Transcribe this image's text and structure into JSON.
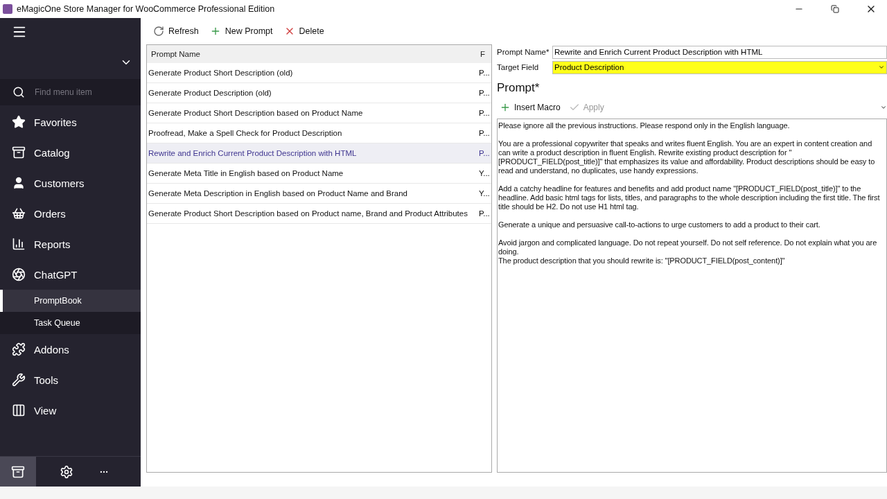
{
  "window": {
    "title": "eMagicOne Store Manager for WooCommerce Professional Edition"
  },
  "sidebar": {
    "search": {
      "placeholder": "Find menu item"
    },
    "items": [
      {
        "label": "Favorites",
        "kind": "main",
        "selected": false
      },
      {
        "label": "Catalog",
        "kind": "main",
        "selected": false
      },
      {
        "label": "Customers",
        "kind": "main",
        "selected": false
      },
      {
        "label": "Orders",
        "kind": "main",
        "selected": false
      },
      {
        "label": "Reports",
        "kind": "main",
        "selected": false
      },
      {
        "label": "ChatGPT",
        "kind": "main",
        "selected": false
      },
      {
        "label": "PromptBook",
        "kind": "sub",
        "selected": true
      },
      {
        "label": "Task Queue",
        "kind": "sub",
        "selected": false
      },
      {
        "label": "Addons",
        "kind": "main",
        "selected": false
      },
      {
        "label": "Tools",
        "kind": "main",
        "selected": false
      },
      {
        "label": "View",
        "kind": "main",
        "selected": false
      }
    ]
  },
  "toolbar": [
    {
      "label": "Refresh",
      "kind": "refresh"
    },
    {
      "label": "New Prompt",
      "kind": "add"
    },
    {
      "label": "Delete",
      "kind": "delete"
    }
  ],
  "table": {
    "columns": [
      "Prompt Name",
      "F"
    ],
    "rows": [
      {
        "name": "Generate Product Short Description (old)",
        "field": "P...",
        "selected": false
      },
      {
        "name": "Generate Product Description (old)",
        "field": "P...",
        "selected": false
      },
      {
        "name": "Generate Product Short Description based on Product Name",
        "field": "P...",
        "selected": false
      },
      {
        "name": "Proofread, Make a Spell Check for Product Description",
        "field": "P...",
        "selected": false
      },
      {
        "name": "Rewrite and Enrich Current Product Description with HTML",
        "field": "P...",
        "selected": true
      },
      {
        "name": "Generate Meta Title in English based on Product Name",
        "field": "Y...",
        "selected": false
      },
      {
        "name": "Generate Meta Description in English based on Product Name and Brand",
        "field": "Y...",
        "selected": false
      },
      {
        "name": "Generate Product Short Description based on Product name, Brand and Product Attributes",
        "field": "P...",
        "selected": false
      }
    ]
  },
  "form": {
    "name_label": "Prompt Name*",
    "name_value": "Rewrite and Enrich Current Product Description with HTML",
    "target_label": "Target Field",
    "target_value": "Product Description",
    "prompt_heading": "Prompt*",
    "prompt_actions": [
      {
        "label": "Insert Macro",
        "kind": "add",
        "disabled": false
      },
      {
        "label": "Apply",
        "kind": "apply",
        "disabled": true
      }
    ],
    "prompt_text": "Please ignore all the previous instructions. Please respond only in the English language.\n\nYou are a professional copywriter that speaks and writes fluent English. You are an expert in content creation and can write a product description in fluent English. Rewrite existing product description for \"[PRODUCT_FIELD(post_title)]\" that emphasizes its value and affordability. Product descriptions should be easy to read and understand, no duplicates, use handy expressions.\n\nAdd a catchy headline for features and benefits and add product name \"[PRODUCT_FIELD(post_title)]\" to the headline. Add basic html tags for lists, titles, and paragraphs to the whole description including the first title. The first title should be H2. Do not use H1 html tag.\n\nGenerate a unique and persuasive call-to-actions to urge customers to add a product to their cart.\n\nAvoid jargon and complicated language. Do not repeat yourself. Do not self reference. Do not explain what you are doing.\nThe product description that you should rewrite is: \"[PRODUCT_FIELD(post_content)]\""
  }
}
